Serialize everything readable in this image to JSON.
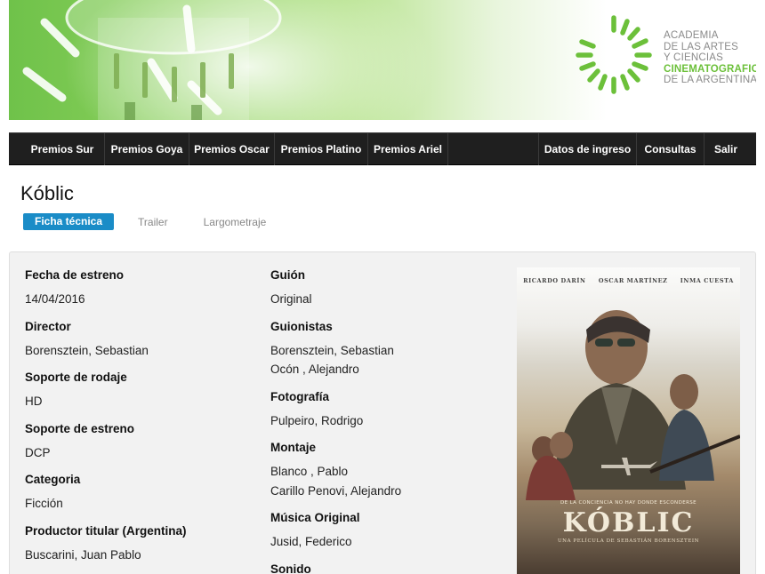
{
  "header": {
    "logo_lines": [
      "ACADEMIA",
      "DE LAS ARTES",
      "Y CIENCIAS",
      "CINEMATOGRAFICAS",
      "DE LA ARGENTINA"
    ],
    "brand_color": "#6cc03a"
  },
  "nav": {
    "left": [
      "Premios Sur",
      "Premios Goya",
      "Premios Oscar",
      "Premios Platino",
      "Premios Ariel"
    ],
    "right": [
      "Datos de ingreso",
      "Consultas",
      "Salir"
    ]
  },
  "movie": {
    "title": "Kóblic"
  },
  "tabs": {
    "items": [
      "Ficha técnica",
      "Trailer",
      "Largometraje"
    ],
    "active_index": 0,
    "active_color": "#1a8cc7"
  },
  "details": {
    "col1": [
      {
        "label": "Fecha de estreno",
        "values": [
          "14/04/2016"
        ]
      },
      {
        "label": "Director",
        "values": [
          "Borensztein, Sebastian"
        ]
      },
      {
        "label": "Soporte de rodaje",
        "values": [
          "HD"
        ]
      },
      {
        "label": "Soporte de estreno",
        "values": [
          "DCP"
        ]
      },
      {
        "label": "Categoria",
        "values": [
          "Ficción"
        ]
      },
      {
        "label": "Productor titular (Argentina)",
        "values": [
          "Buscarini, Juan Pablo"
        ]
      }
    ],
    "col2": [
      {
        "label": "Guión",
        "values": [
          "Original"
        ]
      },
      {
        "label": "Guionistas",
        "values": [
          "Borensztein, Sebastian",
          "Ocón , Alejandro"
        ]
      },
      {
        "label": "Fotografía",
        "values": [
          "Pulpeiro, Rodrigo"
        ]
      },
      {
        "label": "Montaje",
        "values": [
          "Blanco , Pablo",
          "Carillo Penovi, Alejandro"
        ]
      },
      {
        "label": "Música Original",
        "values": [
          "Jusid, Federico"
        ]
      },
      {
        "label": "Sonido",
        "values": []
      }
    ]
  },
  "poster": {
    "credits": [
      "RICARDO DARÍN",
      "OSCAR MARTÍNEZ",
      "INMA CUESTA"
    ],
    "tagline": "DE LA CONCIENCIA NO HAY DONDE ESCONDERSE",
    "title": "KÓBLIC",
    "subtitle": "UNA PELÍCULA DE SEBASTIÁN BORENSZTEIN"
  }
}
